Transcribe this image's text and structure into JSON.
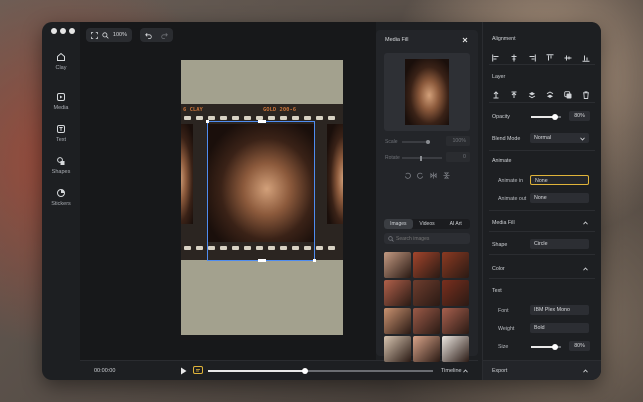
{
  "canvas": {
    "zoom": "100%"
  },
  "sidebar": {
    "items": [
      {
        "label": "Clay",
        "icon": "home-icon"
      },
      {
        "label": "Media",
        "icon": "media-icon"
      },
      {
        "label": "Text",
        "icon": "text-icon"
      },
      {
        "label": "Shapes",
        "icon": "shapes-icon"
      },
      {
        "label": "Stickers",
        "icon": "stickers-icon"
      }
    ]
  },
  "artboard": {
    "film_left_label": "6 CLAY",
    "film_right_label": "GOLD 200-6"
  },
  "media_panel": {
    "title": "Media Fill",
    "scale_label": "Scale",
    "scale_value": "100%",
    "rotate_label": "Rotate",
    "rotate_value": "0",
    "tabs": [
      "Images",
      "Videos",
      "AI Art"
    ],
    "search_placeholder": "Search images",
    "thumb_colors": [
      "#c39a82",
      "#a3452c",
      "#8c3a22",
      "#b0604a",
      "#6d3d2e",
      "#7a2f1e",
      "#c99270",
      "#9b5a48",
      "#a8604e",
      "#d6c4b0",
      "#d8a48a",
      "#ebe6e0"
    ]
  },
  "right_panel": {
    "alignment": "Alignment",
    "layer": "Layer",
    "opacity_label": "Opacity",
    "opacity_value": "80%",
    "opacity_level": 0.8,
    "blend_label": "Blend Mode",
    "blend_value": "Normal",
    "animate_header": "Animate",
    "animate_in_label": "Animate in",
    "animate_in_value": "None",
    "animate_out_label": "Animate out",
    "animate_out_value": "None",
    "media_fill": "Media Fill",
    "shape_label": "Shape",
    "shape_value": "Circle",
    "color_label": "Color",
    "text_header": "Text",
    "font_label": "Font",
    "font_value": "IBM Plex Mono",
    "weight_label": "Weight",
    "weight_value": "Bold",
    "size_label": "Size",
    "size_value": "80%",
    "size_level": 0.8,
    "export_label": "Export",
    "plus": "+"
  },
  "bottom_bar": {
    "time": "00:00:00",
    "timeline_label": "Timeline",
    "progress": 0.43
  },
  "colors": {
    "accent_blue": "#4f8cf0",
    "highlight_yellow": "#e0b43a"
  }
}
